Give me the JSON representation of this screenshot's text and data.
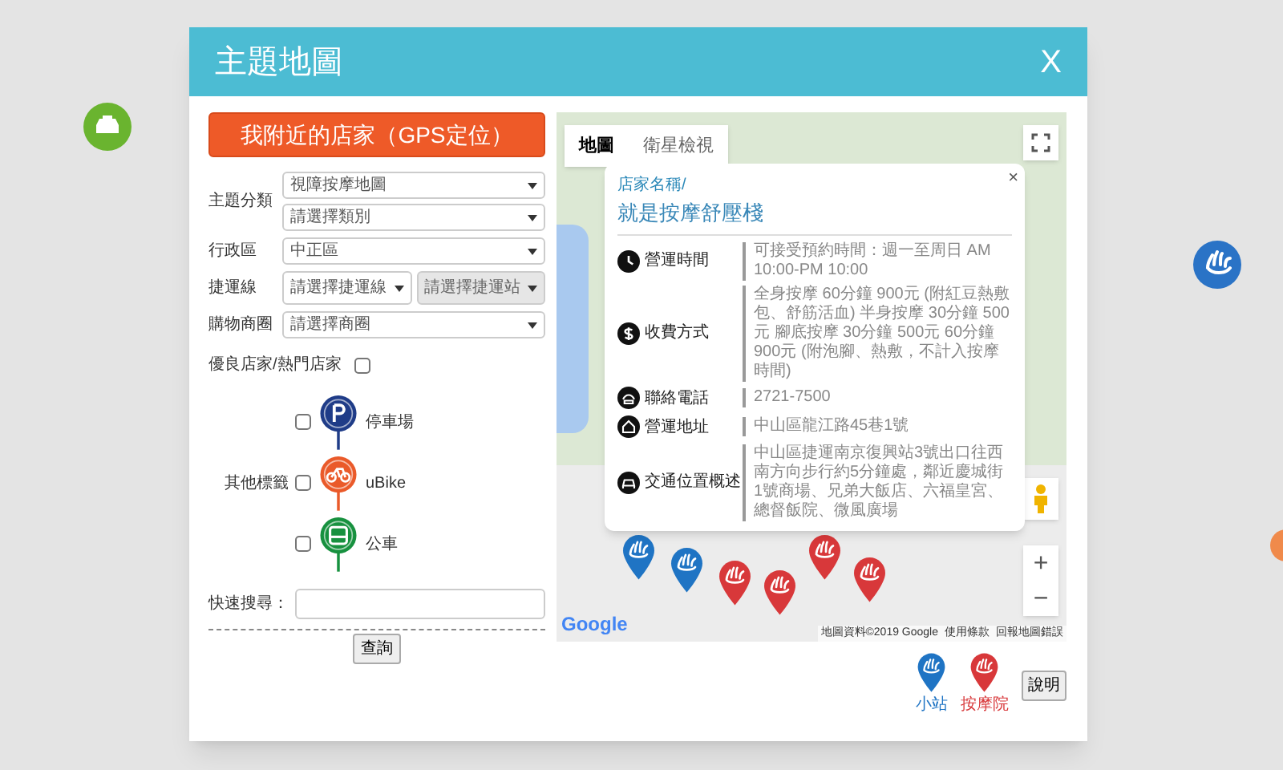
{
  "dialog": {
    "title": "主題地圖",
    "close": "X"
  },
  "form": {
    "gps_button": "我附近的店家（GPS定位）",
    "fields": [
      {
        "label": "主題分類",
        "selects": [
          {
            "value": "視障按摩地圖",
            "disabled": false
          },
          {
            "value": "請選擇類別",
            "disabled": false
          }
        ]
      },
      {
        "label": "行政區",
        "selects": [
          {
            "value": "中正區",
            "disabled": false
          }
        ]
      },
      {
        "label": "捷運線",
        "selects": [
          {
            "value": "請選擇捷運線",
            "disabled": false
          },
          {
            "value": "請選擇捷運站",
            "disabled": true
          }
        ]
      },
      {
        "label": "購物商圈",
        "selects": [
          {
            "value": "請選擇商圈",
            "disabled": false
          }
        ]
      }
    ],
    "featured": {
      "label": "優良店家/熱門店家",
      "checked": false
    },
    "other_markers": {
      "label": "其他標籤",
      "items": [
        {
          "kind": "parking",
          "label": "停車場",
          "checked": false,
          "color": "#1f3c88"
        },
        {
          "kind": "bike",
          "label": "uBike",
          "checked": false,
          "color": "#ea5a2a"
        },
        {
          "kind": "bus",
          "label": "公車",
          "checked": false,
          "color": "#17913f"
        }
      ]
    },
    "quick_search": {
      "label": "快速搜尋："
    },
    "submit": "查詢"
  },
  "map": {
    "tabs": [
      {
        "label": "地圖",
        "selected": true
      },
      {
        "label": "衛星檢視",
        "selected": false
      }
    ],
    "zoom_in": "+",
    "zoom_out": "−",
    "logo": "Google",
    "attribution": [
      "地圖資料©2019 Google",
      "使用條款",
      "回報地圖錯誤"
    ],
    "info_window": {
      "close": "×",
      "name_label": "店家名稱/",
      "name": "就是按摩舒壓棧",
      "rows": [
        {
          "kind": "clock",
          "label": "營運時間",
          "value": "可接受預約時間：週一至周日 AM 10:00-PM 10:00"
        },
        {
          "kind": "money",
          "label": "收費方式",
          "value": "全身按摩 60分鐘 900元 (附紅豆熱敷包、舒筋活血) 半身按摩 30分鐘 500元 腳底按摩 30分鐘 500元 60分鐘 900元 (附泡腳、熱敷，不計入按摩時間)"
        },
        {
          "kind": "phone",
          "label": "聯絡電話",
          "value": "2721-7500"
        },
        {
          "kind": "home",
          "label": "營運地址",
          "value": "中山區龍江路45巷1號"
        },
        {
          "kind": "car",
          "label": "交通位置概述",
          "value": "中山區捷運南京復興站3號出口往西南方向步行約5分鐘處，鄰近慶城街1號商場、兄弟大飯店、六福皇宮、總督飯院、微風廣場"
        }
      ]
    }
  },
  "legend": [
    {
      "label": "小站",
      "color": "#1f74c4"
    },
    {
      "label": "按摩院",
      "color": "#d8383a"
    }
  ],
  "help_button": "說明"
}
